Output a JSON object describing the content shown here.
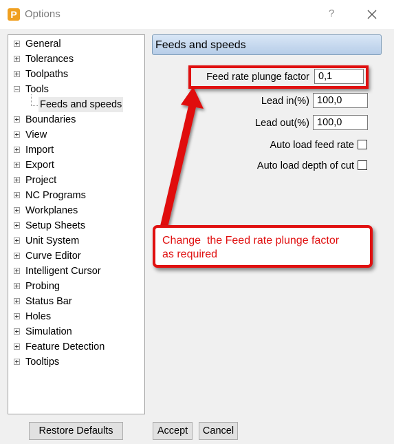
{
  "window": {
    "app_icon_letter": "P",
    "title": "Options",
    "help_label": "?",
    "close_icon": "close-icon"
  },
  "tree": {
    "items": [
      {
        "label": "General",
        "expanded": false
      },
      {
        "label": "Tolerances",
        "expanded": false
      },
      {
        "label": "Toolpaths",
        "expanded": false
      },
      {
        "label": "Tools",
        "expanded": true
      },
      {
        "label": "Boundaries",
        "expanded": false
      },
      {
        "label": "View",
        "expanded": false
      },
      {
        "label": "Import",
        "expanded": false
      },
      {
        "label": "Export",
        "expanded": false
      },
      {
        "label": "Project",
        "expanded": false
      },
      {
        "label": "NC Programs",
        "expanded": false
      },
      {
        "label": "Workplanes",
        "expanded": false
      },
      {
        "label": "Setup Sheets",
        "expanded": false
      },
      {
        "label": "Unit System",
        "expanded": false
      },
      {
        "label": "Curve Editor",
        "expanded": false
      },
      {
        "label": "Intelligent Cursor",
        "expanded": false
      },
      {
        "label": "Probing",
        "expanded": false
      },
      {
        "label": "Status Bar",
        "expanded": false
      },
      {
        "label": "Holes",
        "expanded": false
      },
      {
        "label": "Simulation",
        "expanded": false
      },
      {
        "label": "Feature Detection",
        "expanded": false
      },
      {
        "label": "Tooltips",
        "expanded": false
      }
    ],
    "selected_child": "Feeds and speeds"
  },
  "panel": {
    "title": "Feeds and speeds",
    "feed_rate_plunge_factor": {
      "label": "Feed rate plunge factor",
      "value": "0,1"
    },
    "lead_in": {
      "label": "Lead in(%)",
      "value": "100,0"
    },
    "lead_out": {
      "label": "Lead out(%)",
      "value": "100,0"
    },
    "auto_load_feed_rate": {
      "label": "Auto load feed rate",
      "checked": false
    },
    "auto_load_depth_of_cut": {
      "label": "Auto load depth of cut",
      "checked": false
    }
  },
  "annotation": {
    "callout_text": "Change  the Feed rate plunge factor\nas required",
    "color": "#e01010"
  },
  "buttons": {
    "restore_defaults": "Restore Defaults",
    "accept": "Accept",
    "cancel": "Cancel"
  }
}
